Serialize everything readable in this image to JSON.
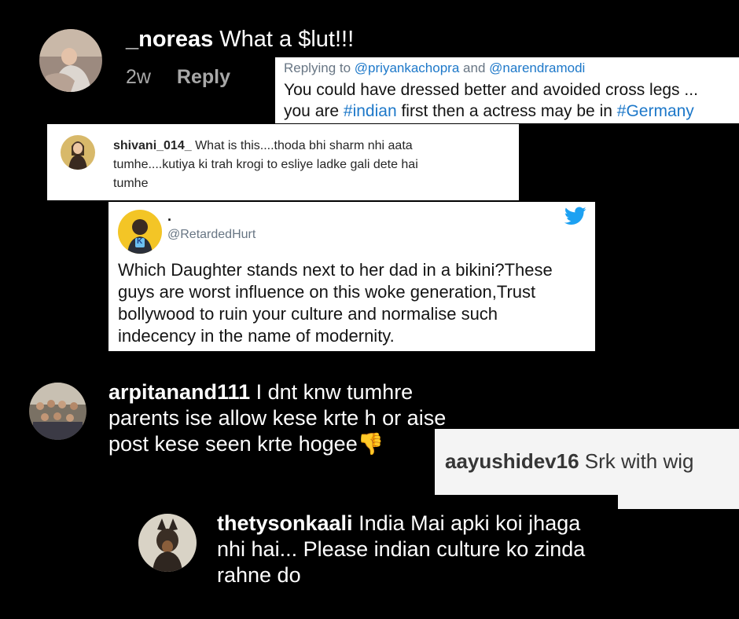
{
  "c1": {
    "username": "_noreas",
    "text": "What a $lut!!!",
    "time": "2w",
    "reply": "Reply"
  },
  "c2": {
    "replying_prefix": "Replying to",
    "mention1": "@priyankachopra",
    "and": "and",
    "mention2": "@narendramodi",
    "line1": "You could have dressed better and avoided cross legs ...",
    "line2_a": "you are",
    "hashtag1": "#indian",
    "line2_b": "first then a actress may be in",
    "hashtag2": "#Germany"
  },
  "c3": {
    "username": "shivani_014_",
    "line1": "What is this....thoda bhi sharm nhi aata",
    "line2": "tumhe....kutiya ki trah krogi to esliye ladke gali dete hai",
    "line3": "tumhe"
  },
  "c4": {
    "name": ".",
    "handle": "@RetardedHurt",
    "line1": "Which Daughter stands next to her dad in a bikini?These",
    "line2": "guys are worst influence on this woke generation,Trust",
    "line3": "bollywood to ruin your culture and normalise such",
    "line4": "indecency in the name of modernity.",
    "avatar_letter": "K"
  },
  "c5": {
    "username": "arpitanand111",
    "line1": "I dnt knw tumhre",
    "line2": "parents ise allow kese krte h or aise",
    "line3": "post kese seen krte hogee",
    "emoji": "👎"
  },
  "c6": {
    "username": "aayushidev16",
    "text": "Srk with wig"
  },
  "c7": {
    "username": "thetysonkaali",
    "line1": "India Mai apki koi jhaga",
    "line2": "nhi hai... Please indian culture ko zinda",
    "line3": "rahne do"
  },
  "colors": {
    "background": "#000000",
    "link_blue": "#1d78c9",
    "twitter_blue": "#1da1f2",
    "thumb_yellow": "#f7b500"
  }
}
